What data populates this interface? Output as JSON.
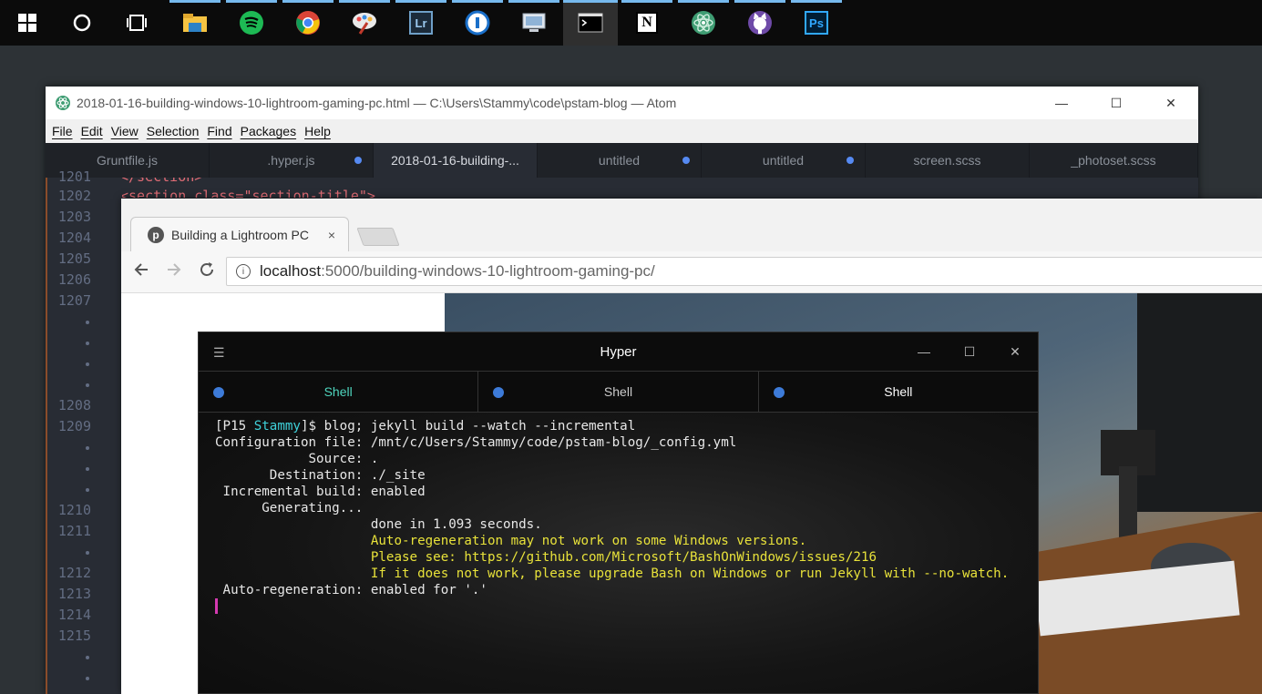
{
  "taskbar": {
    "icons": [
      "windows-start-icon",
      "cortana-icon",
      "task-view-icon",
      "file-explorer-icon",
      "spotify-icon",
      "chrome-icon",
      "paint-icon",
      "lightroom-icon",
      "1password-icon",
      "remote-desktop-icon",
      "terminal-icon",
      "notion-icon",
      "atom-icon",
      "github-icon",
      "photoshop-icon"
    ],
    "lightroom_label": "Lr",
    "photoshop_label": "Ps",
    "notion_label": "N"
  },
  "atom": {
    "title": "2018-01-16-building-windows-10-lightroom-gaming-pc.html — C:\\Users\\Stammy\\code\\pstam-blog — Atom",
    "menu": [
      "File",
      "Edit",
      "View",
      "Selection",
      "Find",
      "Packages",
      "Help"
    ],
    "tabs": [
      {
        "label": "Gruntfile.js",
        "modified": false,
        "active": false
      },
      {
        "label": ".hyper.js",
        "modified": true,
        "active": false
      },
      {
        "label": "2018-01-16-building-...",
        "modified": false,
        "active": true
      },
      {
        "label": "untitled",
        "modified": true,
        "active": false
      },
      {
        "label": "untitled",
        "modified": true,
        "active": false
      },
      {
        "label": "screen.scss",
        "modified": false,
        "active": false
      },
      {
        "label": "_photoset.scss",
        "modified": false,
        "active": false
      }
    ],
    "code_peek_1": "</section>",
    "code_peek_2": "<section class=\"section-title\">",
    "line_numbers": [
      "1201",
      "1202",
      "1203",
      "1204",
      "1205",
      "1206",
      "1207",
      "1208",
      "1209",
      "1210",
      "1211",
      "1212",
      "1213",
      "1214",
      "1215"
    ]
  },
  "chrome": {
    "tab_title": "Building a Lightroom PC",
    "tab_close": "×",
    "favicon_letter": "p",
    "url_host": "localhost",
    "url_path": ":5000/building-windows-10-lightroom-gaming-pc/"
  },
  "hyper": {
    "title": "Hyper",
    "menu_icon": "☰",
    "tabs": [
      "Shell",
      "Shell",
      "Shell"
    ],
    "prompt_open": "[P15 ",
    "prompt_user": "Stammy",
    "prompt_close": "]$ ",
    "command": "blog; jekyll build --watch --incremental",
    "output": [
      "Configuration file: /mnt/c/Users/Stammy/code/pstam-blog/_config.yml",
      "            Source: .",
      "       Destination: ./_site",
      " Incremental build: enabled",
      "      Generating...",
      "                    done in 1.093 seconds."
    ],
    "warnings": [
      "                    Auto-regeneration may not work on some Windows versions.",
      "                    Please see: https://github.com/Microsoft/BashOnWindows/issues/216",
      "                    If it does not work, please upgrade Bash on Windows or run Jekyll with --no-watch."
    ],
    "final_line": " Auto-regeneration: enabled for '.'"
  },
  "colors": {
    "accent": "#76b9ed",
    "terminal_user": "#3fd0d9",
    "terminal_warn": "#e8e23a",
    "cursor": "#d43ab0",
    "tab_dot": "#3d7bd9"
  }
}
